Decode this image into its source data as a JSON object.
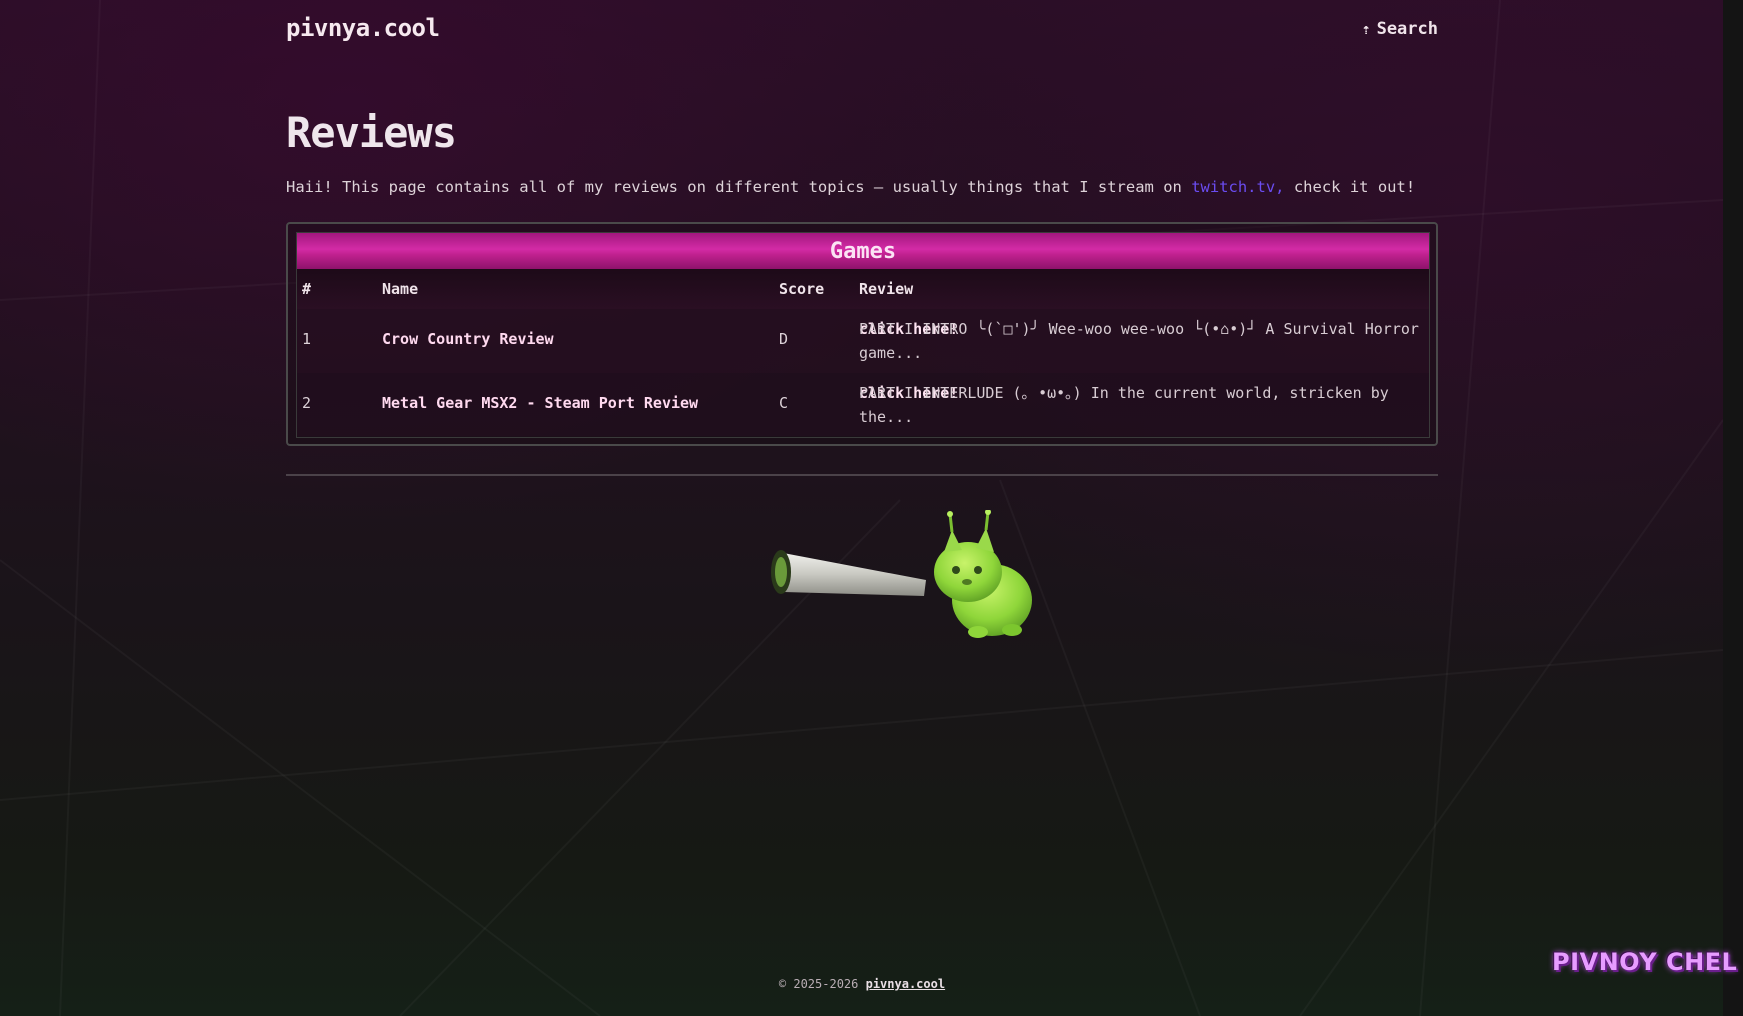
{
  "header": {
    "site_title": "pivnya.cool",
    "search_label": "Search",
    "search_icon": "arrow-up-icon"
  },
  "main": {
    "title": "Reviews",
    "intro_before": "Haii! This page contains all of my reviews on different topics — usually things that I stream on ",
    "intro_link": "twitch.tv,",
    "intro_after": " check it out!"
  },
  "games_table": {
    "caption": "Games",
    "columns": [
      "#",
      "Name",
      "Score",
      "Review"
    ],
    "rows": [
      {
        "num": "1",
        "name": "Crow Country Review",
        "score": "D",
        "review": "PART I INTRO ╰(`□')╯ Wee-woo wee-woo └(•⌂•)┘ A Survival Horror game...",
        "link": "click here!"
      },
      {
        "num": "2",
        "name": "Metal Gear MSX2 - Steam Port Review",
        "score": "C",
        "review": "PART I INTERLUDE (｡ •ω•｡) In the current world, stricken by the...",
        "link": "click here!"
      }
    ]
  },
  "footer": {
    "copyright": "© 2025-2026 ",
    "link": "pivnya.cool"
  },
  "badge": {
    "text": "PIVNOY CHEL"
  },
  "colors": {
    "accent_pink": "#c0218f",
    "link_purple": "#6a4cf0",
    "badge_purple": "#e79cff"
  }
}
